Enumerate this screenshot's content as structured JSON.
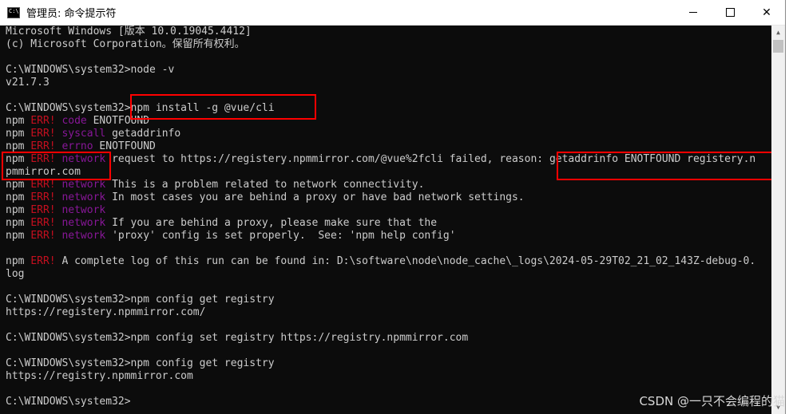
{
  "window": {
    "title": "管理员: 命令提示符",
    "icon_text": "C:\\"
  },
  "controls": {
    "minimize": "minimize",
    "maximize": "maximize",
    "close": "✕"
  },
  "console_lines": [
    [
      {
        "t": "Microsoft Windows [版本 10.0.19045.4412]",
        "c": "n"
      }
    ],
    [
      {
        "t": "(c) Microsoft Corporation。保留所有权利。",
        "c": "n"
      }
    ],
    [],
    [
      {
        "t": "C:\\WINDOWS\\system32>node -v",
        "c": "n"
      }
    ],
    [
      {
        "t": "v21.7.3",
        "c": "n"
      }
    ],
    [],
    [
      {
        "t": "C:\\WINDOWS\\system32>npm install -g @vue/cli",
        "c": "n"
      }
    ],
    [
      {
        "t": "npm ",
        "c": "n"
      },
      {
        "t": "ERR!",
        "c": "e"
      },
      {
        "t": " ",
        "c": "n"
      },
      {
        "t": "code",
        "c": "k"
      },
      {
        "t": " ENOTFOUND",
        "c": "n"
      }
    ],
    [
      {
        "t": "npm ",
        "c": "n"
      },
      {
        "t": "ERR!",
        "c": "e"
      },
      {
        "t": " ",
        "c": "n"
      },
      {
        "t": "syscall",
        "c": "k"
      },
      {
        "t": " getaddrinfo",
        "c": "n"
      }
    ],
    [
      {
        "t": "npm ",
        "c": "n"
      },
      {
        "t": "ERR!",
        "c": "e"
      },
      {
        "t": " ",
        "c": "n"
      },
      {
        "t": "errno",
        "c": "k"
      },
      {
        "t": " ENOTFOUND",
        "c": "n"
      }
    ],
    [
      {
        "t": "npm ",
        "c": "n"
      },
      {
        "t": "ERR!",
        "c": "e"
      },
      {
        "t": " ",
        "c": "n"
      },
      {
        "t": "network",
        "c": "k"
      },
      {
        "t": " request to https://registery.npmmirror.com/@vue%2fcli failed, reason: getaddrinfo ENOTFOUND registery.n",
        "c": "n"
      }
    ],
    [
      {
        "t": "pmmirror.com",
        "c": "n"
      }
    ],
    [
      {
        "t": "npm ",
        "c": "n"
      },
      {
        "t": "ERR!",
        "c": "e"
      },
      {
        "t": " ",
        "c": "n"
      },
      {
        "t": "network",
        "c": "k"
      },
      {
        "t": " This is a problem related to network connectivity.",
        "c": "n"
      }
    ],
    [
      {
        "t": "npm ",
        "c": "n"
      },
      {
        "t": "ERR!",
        "c": "e"
      },
      {
        "t": " ",
        "c": "n"
      },
      {
        "t": "network",
        "c": "k"
      },
      {
        "t": " In most cases you are behind a proxy or have bad network settings.",
        "c": "n"
      }
    ],
    [
      {
        "t": "npm ",
        "c": "n"
      },
      {
        "t": "ERR!",
        "c": "e"
      },
      {
        "t": " ",
        "c": "n"
      },
      {
        "t": "network",
        "c": "k"
      }
    ],
    [
      {
        "t": "npm ",
        "c": "n"
      },
      {
        "t": "ERR!",
        "c": "e"
      },
      {
        "t": " ",
        "c": "n"
      },
      {
        "t": "network",
        "c": "k"
      },
      {
        "t": " If you are behind a proxy, please make sure that the",
        "c": "n"
      }
    ],
    [
      {
        "t": "npm ",
        "c": "n"
      },
      {
        "t": "ERR!",
        "c": "e"
      },
      {
        "t": " ",
        "c": "n"
      },
      {
        "t": "network",
        "c": "k"
      },
      {
        "t": " 'proxy' config is set properly.  See: 'npm help config'",
        "c": "n"
      }
    ],
    [],
    [
      {
        "t": "npm ",
        "c": "n"
      },
      {
        "t": "ERR!",
        "c": "e"
      },
      {
        "t": " A complete log of this run can be found in: D:\\software\\node\\node_cache\\_logs\\2024-05-29T02_21_02_143Z-debug-0.",
        "c": "n"
      }
    ],
    [
      {
        "t": "log",
        "c": "n"
      }
    ],
    [],
    [
      {
        "t": "C:\\WINDOWS\\system32>npm config get registry",
        "c": "n"
      }
    ],
    [
      {
        "t": "https://registery.npmmirror.com/",
        "c": "n"
      }
    ],
    [],
    [
      {
        "t": "C:\\WINDOWS\\system32>npm config set registry https://registry.npmmirror.com",
        "c": "n"
      }
    ],
    [],
    [
      {
        "t": "C:\\WINDOWS\\system32>npm config get registry",
        "c": "n"
      }
    ],
    [
      {
        "t": "https://registry.npmmirror.com",
        "c": "n"
      }
    ],
    [],
    [
      {
        "t": "C:\\WINDOWS\\system32>",
        "c": "n"
      }
    ]
  ],
  "colors": {
    "background": "#0c0c0c",
    "text": "#cccccc",
    "err": "#c50f1f",
    "keyword": "#881798",
    "highlight_box": "#ff0000"
  },
  "scrollbar": {
    "up": "▲",
    "down": "▼"
  },
  "watermark": "CSDN @一只不会编程的猫"
}
